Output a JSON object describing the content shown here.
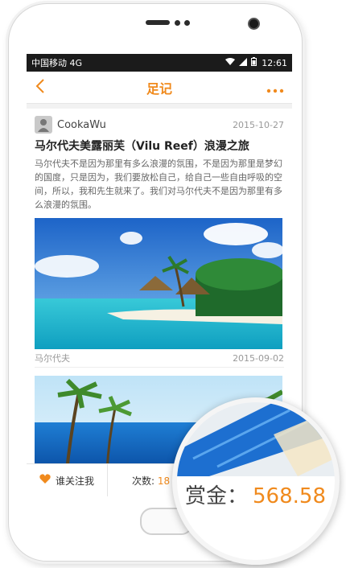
{
  "status_bar": {
    "carrier": "中国移动 4G",
    "time": "12:61"
  },
  "nav": {
    "back_icon": "chevron-left-icon",
    "title": "足记",
    "more_icon": "more-icon"
  },
  "post": {
    "author": "CookaWu",
    "date": "2015-10-27",
    "title": "马尔代夫美露丽芙（Vilu Reef）浪漫之旅",
    "body": "马尔代夫不是因为那里有多么浪漫的氛围，不是因为那里是梦幻的国度，只是因为，我们要放松自己，给自己一些自由呼吸的空间，所以，我和先生就来了。我们对马尔代夫不是因为那里有多么浪漫的氛围。",
    "photo_location": "马尔代夫",
    "photo_date": "2015-09-02"
  },
  "bottom_bar": {
    "follow_label": "谁关注我",
    "views_label": "次数:",
    "views_count": "18"
  },
  "magnifier": {
    "reward_label": "赏金：",
    "reward_amount": "568.58"
  },
  "colors": {
    "accent": "#f08a1d"
  }
}
